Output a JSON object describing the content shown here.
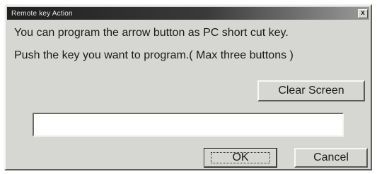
{
  "window": {
    "title": "Remote key Action",
    "close_glyph": "x"
  },
  "message": {
    "line1": "You can program the arrow button as PC short cut key.",
    "line2": "Push the key you want to program.( Max three buttons )"
  },
  "buttons": {
    "clear_label": "Clear Screen",
    "ok_label": "OK",
    "cancel_label": "Cancel"
  },
  "key_input": {
    "value": "",
    "placeholder": ""
  }
}
